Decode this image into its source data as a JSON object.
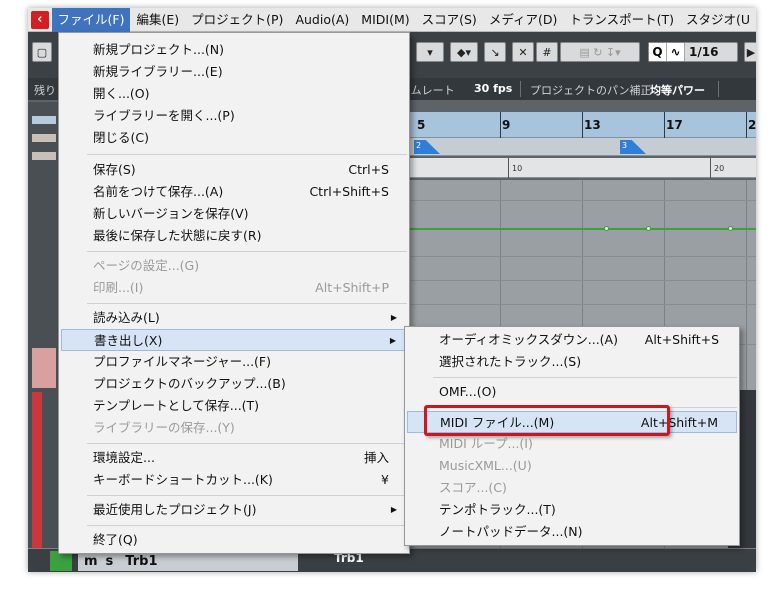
{
  "menubar": {
    "items": [
      {
        "label": "ファイル(F)",
        "active": true
      },
      {
        "label": "編集(E)"
      },
      {
        "label": "プロジェクト(P)"
      },
      {
        "label": "Audio(A)"
      },
      {
        "label": "MIDI(M)"
      },
      {
        "label": "スコア(S)"
      },
      {
        "label": "メディア(D)"
      },
      {
        "label": "トランスポート(T)"
      },
      {
        "label": "スタジオ(U"
      }
    ]
  },
  "toolbar": {
    "quantize_label": "Q",
    "quantize_value": "1/16",
    "left_label": "残り",
    "frame_rate_label": "ームレート",
    "fps": "30 fps",
    "pan_label": "プロジェクトのパン補正",
    "pan_value": "均等パワー"
  },
  "ruler": {
    "bars": [
      "5",
      "9",
      "13",
      "17",
      "2"
    ]
  },
  "markers": [
    "2",
    "3"
  ],
  "tempo": [
    "10",
    "20"
  ],
  "track": {
    "name": "Trb1",
    "clip_label": "Trb1",
    "mute": "m",
    "solo": "s"
  },
  "file_menu": {
    "items": [
      {
        "label": "新規プロジェクト...(N)"
      },
      {
        "label": "新規ライブラリー...(E)"
      },
      {
        "label": "開く...(O)"
      },
      {
        "label": "ライブラリーを開く...(P)"
      },
      {
        "label": "閉じる(C)"
      },
      {
        "label": "保存(S)",
        "shortcut": "Ctrl+S"
      },
      {
        "label": "名前をつけて保存...(A)",
        "shortcut": "Ctrl+Shift+S"
      },
      {
        "label": "新しいバージョンを保存(V)"
      },
      {
        "label": "最後に保存した状態に戻す(R)"
      },
      {
        "label": "ページの設定...(G)",
        "disabled": true
      },
      {
        "label": "印刷...(I)",
        "shortcut": "Alt+Shift+P",
        "disabled": true
      },
      {
        "label": "読み込み(L)",
        "submenu": true
      },
      {
        "label": "書き出し(X)",
        "submenu": true,
        "highlight": true
      },
      {
        "label": "プロファイルマネージャー...(F)"
      },
      {
        "label": "プロジェクトのバックアップ...(B)"
      },
      {
        "label": "テンプレートとして保存...(T)"
      },
      {
        "label": "ライブラリーの保存...(Y)",
        "disabled": true
      },
      {
        "label": "環境設定...",
        "shortcut": "挿入"
      },
      {
        "label": "キーボードショートカット...(K)",
        "shortcut": "¥"
      },
      {
        "label": "最近使用したプロジェクト(J)",
        "submenu": true
      },
      {
        "label": "終了(Q)"
      }
    ]
  },
  "export_menu": {
    "items": [
      {
        "label": "オーディオミックスダウン...(A)",
        "shortcut": "Alt+Shift+S"
      },
      {
        "label": "選択されたトラック...(S)"
      },
      {
        "label": "OMF...(O)"
      },
      {
        "label": "MIDI ファイル...(M)",
        "shortcut": "Alt+Shift+M",
        "highlight": true
      },
      {
        "label": "MIDI ループ...(I)",
        "disabled": true
      },
      {
        "label": "MusicXML...(U)",
        "disabled": true
      },
      {
        "label": "スコア...(C)",
        "disabled": true
      },
      {
        "label": "テンポトラック...(T)"
      },
      {
        "label": "ノートパッドデータ...(N)"
      }
    ]
  },
  "colors": {
    "accent": "#3f73c0",
    "highlight_box": "#d0161c",
    "ruler": "#a8c3dc"
  }
}
